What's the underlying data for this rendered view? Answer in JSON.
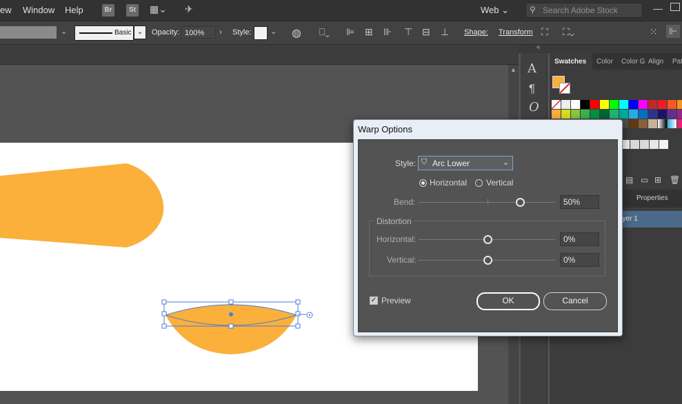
{
  "menubar": {
    "items": [
      "ew",
      "Window",
      "Help"
    ],
    "badges": [
      "Br",
      "St"
    ],
    "workspace": "Web",
    "search_placeholder": "Search Adobe Stock"
  },
  "controlbar": {
    "stroke_profile": "Basic",
    "opacity_label": "Opacity:",
    "opacity_value": "100%",
    "style_label": "Style:",
    "shape_label": "Shape:",
    "transform_label": "Transform"
  },
  "panels": {
    "tabs": [
      "Swatches",
      "Color",
      "Color G",
      "Align",
      "Pat"
    ],
    "layers_tabs": [
      "Properties"
    ],
    "layer_name": "ayer 1"
  },
  "dialog": {
    "title": "Warp Options",
    "style_label": "Style:",
    "style_value": "Arc Lower",
    "orientation": {
      "horizontal": "Horizontal",
      "vertical": "Vertical",
      "selected": "horizontal"
    },
    "bend_label": "Bend:",
    "bend_value": "50%",
    "distortion_group": "Distortion",
    "dist_horizontal_label": "Horizontal:",
    "dist_horizontal_value": "0%",
    "dist_vertical_label": "Vertical:",
    "dist_vertical_value": "0%",
    "preview_label": "Preview",
    "preview_checked": true,
    "ok_label": "OK",
    "cancel_label": "Cancel"
  },
  "colors": {
    "shape_fill": "#fbb03b",
    "selection": "#4a7bd6"
  }
}
